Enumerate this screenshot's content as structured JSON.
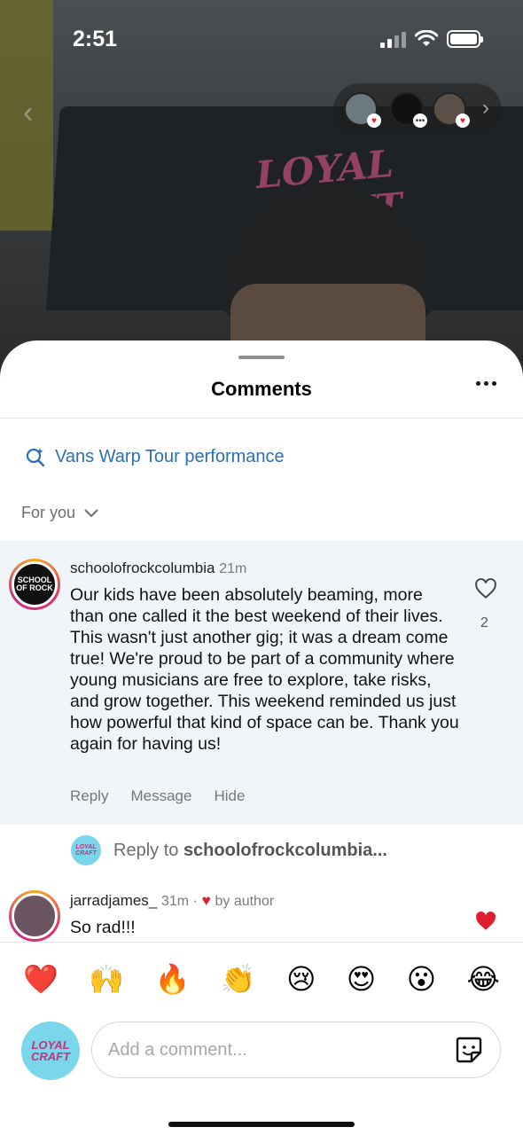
{
  "status": {
    "time": "2:51"
  },
  "sheet": {
    "title": "Comments"
  },
  "search": {
    "label": "Vans Warp Tour performance"
  },
  "filter": {
    "label": "For you"
  },
  "comments": [
    {
      "username": "schoolofrockcolumbia",
      "time": "21m",
      "text": "Our kids have been absolutely beaming, more than one called it the best weekend of their lives. This wasn't just another gig; it was a dream come true! We're proud to be part of a community where young musicians are free to explore, take risks, and grow together. This weekend reminded us just how powerful that kind of space can be. Thank you again for having us!",
      "likes": "2",
      "actions": {
        "reply": "Reply",
        "message": "Message",
        "hide": "Hide"
      }
    },
    {
      "username": "jarradjames_",
      "time": "31m ·",
      "author_tag": "by author",
      "text": "So rad!!!"
    }
  ],
  "reply_prompt": {
    "prefix": "Reply to",
    "target": "schoolofrockcolumbia..."
  },
  "emojis": [
    "❤️",
    "🙌",
    "🔥",
    "👏",
    "😢",
    "😍",
    "😮",
    "😂"
  ],
  "composer": {
    "placeholder": "Add a comment..."
  },
  "colors": {
    "link_blue": "#2a6fb8",
    "highlight_bg": "#f0f5fa",
    "heart_red": "#e11d2e"
  }
}
